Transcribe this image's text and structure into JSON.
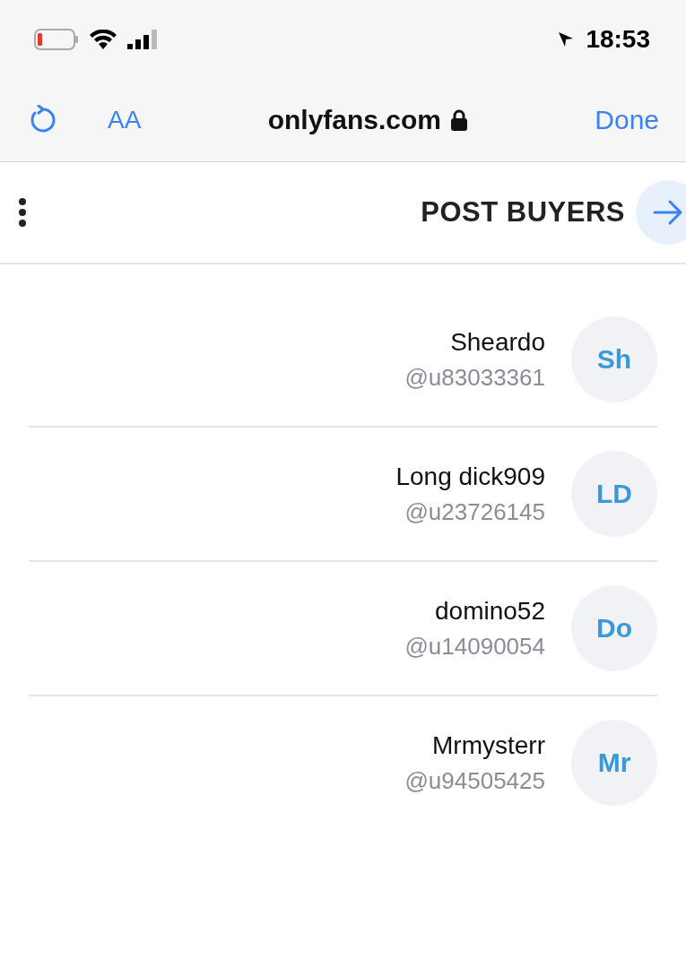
{
  "status_bar": {
    "time": "18:53"
  },
  "browser_bar": {
    "done": "Done",
    "domain": "onlyfans.com",
    "text_size": "AA"
  },
  "header": {
    "title": "POST BUYERS"
  },
  "buyers": [
    {
      "initials": "Sh",
      "name": "Sheardo",
      "handle": "@u83033361"
    },
    {
      "initials": "LD",
      "name": "Long dick909",
      "handle": "@u23726145"
    },
    {
      "initials": "Do",
      "name": "domino52",
      "handle": "@u14090054"
    },
    {
      "initials": "Mr",
      "name": "Mrmysterr",
      "handle": "@u94505425"
    }
  ]
}
